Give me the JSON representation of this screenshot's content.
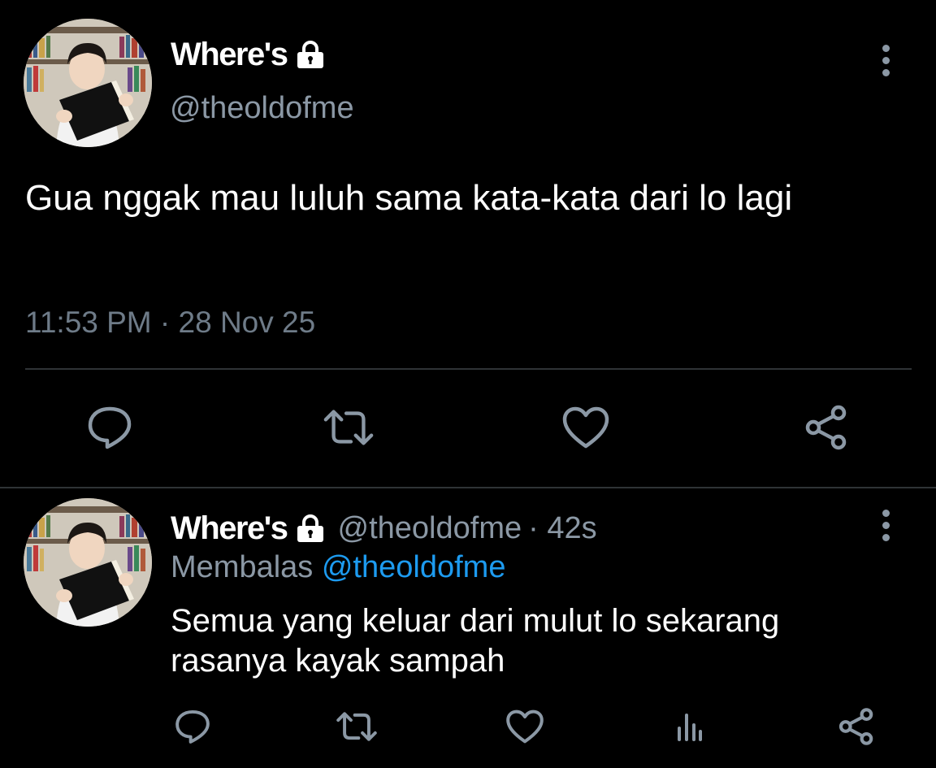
{
  "main_tweet": {
    "display_name": "Where's",
    "handle": "@theoldofme",
    "text": "Gua nggak mau luluh sama kata-kata dari lo lagi",
    "timestamp": "11:53 PM · 28 Nov 25",
    "actions": [
      "reply-icon",
      "retweet-icon",
      "like-icon",
      "share-icon"
    ]
  },
  "reply_tweet": {
    "display_name": "Where's",
    "handle": "@theoldofme",
    "time_ago": "· 42s",
    "replying_label": "Membalas",
    "replying_to": "@theoldofme",
    "text": "Semua yang keluar dari mulut lo sekarang rasanya kayak sampah",
    "actions": [
      "reply-icon",
      "retweet-icon",
      "like-icon",
      "analytics-icon",
      "share-icon"
    ]
  },
  "colors": {
    "background": "#000000",
    "text": "#ffffff",
    "secondary": "#8b98a5",
    "link": "#1d9bf0",
    "divider": "#2f3336"
  }
}
